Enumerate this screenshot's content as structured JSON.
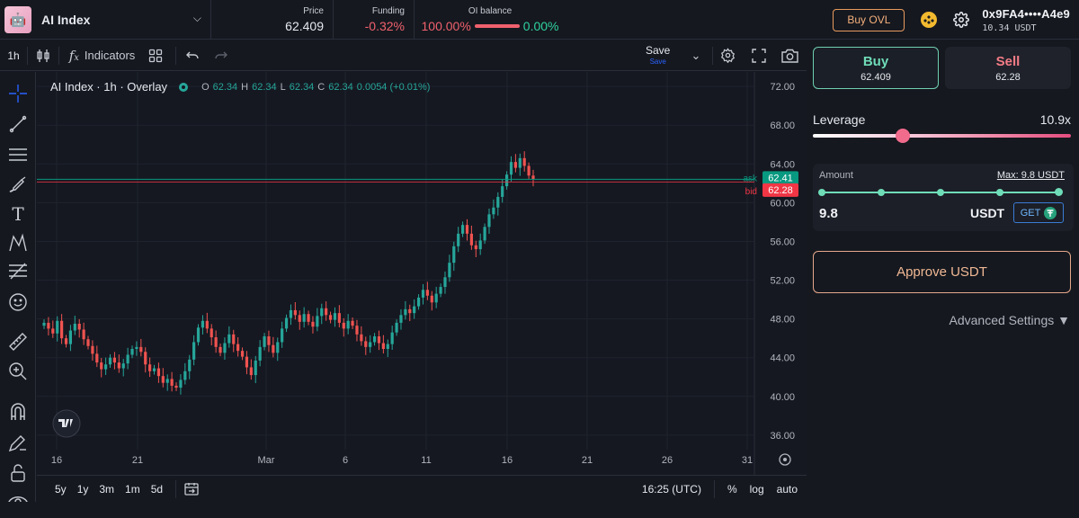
{
  "header": {
    "market_name": "AI Index",
    "price_label": "Price",
    "price_value": "62.409",
    "funding_label": "Funding",
    "funding_value": "-0.32%",
    "oi_label": "OI balance",
    "oi_left": "100.00%",
    "oi_right": "0.00%",
    "buy_ovl": "Buy OVL",
    "wallet_address": "0x9FA4••••A4e9",
    "wallet_balance": "10.34 USDT"
  },
  "toolbar": {
    "timeframe": "1h",
    "indicators": "Indicators",
    "save": "Save",
    "save_sub": "Save"
  },
  "legend": {
    "title": "AI Index · 1h · Overlay",
    "o_label": "O",
    "o_value": "62.34",
    "h_label": "H",
    "h_value": "62.34",
    "l_label": "L",
    "l_value": "62.34",
    "c_label": "C",
    "c_value": "62.34",
    "change": "0.0054 (+0.01%)"
  },
  "chart_data": {
    "type": "candlestick",
    "y_ticks": [
      "72.00",
      "68.00",
      "64.00",
      "60.00",
      "56.00",
      "52.00",
      "48.00",
      "44.00",
      "40.00",
      "36.00"
    ],
    "ylim": [
      34.5,
      73.5
    ],
    "x_ticks": [
      "16",
      "21",
      "Mar",
      "6",
      "11",
      "16",
      "21",
      "26",
      "31"
    ],
    "ask_label": "ask",
    "ask_value": 62.41,
    "ask_text": "62.41",
    "bid_label": "bid",
    "bid_value": 62.28,
    "bid_text": "62.28",
    "closes": [
      47.6,
      47.0,
      46.5,
      47.8,
      46.0,
      45.4,
      46.8,
      47.5,
      46.9,
      45.9,
      45.2,
      44.4,
      43.5,
      42.8,
      43.3,
      44.0,
      43.5,
      42.9,
      43.4,
      44.3,
      44.9,
      45.1,
      44.6,
      43.3,
      42.6,
      42.9,
      42.1,
      41.4,
      41.8,
      41.1,
      40.9,
      41.7,
      42.6,
      43.8,
      45.6,
      47.1,
      47.8,
      47.0,
      46.1,
      45.1,
      44.5,
      45.5,
      46.4,
      45.4,
      44.7,
      44.1,
      43.0,
      42.2,
      43.7,
      45.1,
      46.2,
      45.3,
      44.5,
      45.6,
      47.0,
      48.1,
      48.9,
      48.4,
      47.7,
      48.5,
      47.7,
      47.2,
      48.3,
      49.1,
      48.4,
      47.9,
      48.6,
      47.6,
      47.0,
      47.8,
      47.3,
      46.4,
      45.7,
      45.1,
      45.6,
      46.2,
      45.5,
      44.9,
      45.4,
      46.6,
      47.6,
      48.4,
      49.0,
      48.6,
      49.3,
      50.2,
      51.0,
      50.4,
      49.7,
      50.6,
      51.3,
      52.3,
      53.8,
      55.5,
      56.8,
      57.7,
      56.8,
      55.6,
      55.2,
      56.1,
      57.5,
      58.8,
      59.5,
      60.6,
      61.7,
      62.9,
      64.2,
      63.6,
      64.6,
      63.8,
      62.8,
      62.4
    ]
  },
  "bottom": {
    "r5y": "5y",
    "r1y": "1y",
    "r3m": "3m",
    "r1m": "1m",
    "r5d": "5d",
    "time": "16:25 (UTC)",
    "pct": "%",
    "log": "log",
    "auto": "auto"
  },
  "panel": {
    "buy_label": "Buy",
    "buy_price": "62.409",
    "sell_label": "Sell",
    "sell_price": "62.28",
    "leverage_label": "Leverage",
    "leverage_value": "10.9x",
    "leverage_fraction": 0.35,
    "amount_label": "Amount",
    "max_label": "Max: 9.8 USDT",
    "amount_value": "9.8",
    "amount_unit": "USDT",
    "get_label": "GET",
    "approve_label": "Approve USDT",
    "advanced_label": "Advanced Settings ▼"
  },
  "colors": {
    "up": "#26a69a",
    "down": "#ef5350",
    "ask": "#089981",
    "bid": "#f23645",
    "accent": "#6fdcb8"
  }
}
